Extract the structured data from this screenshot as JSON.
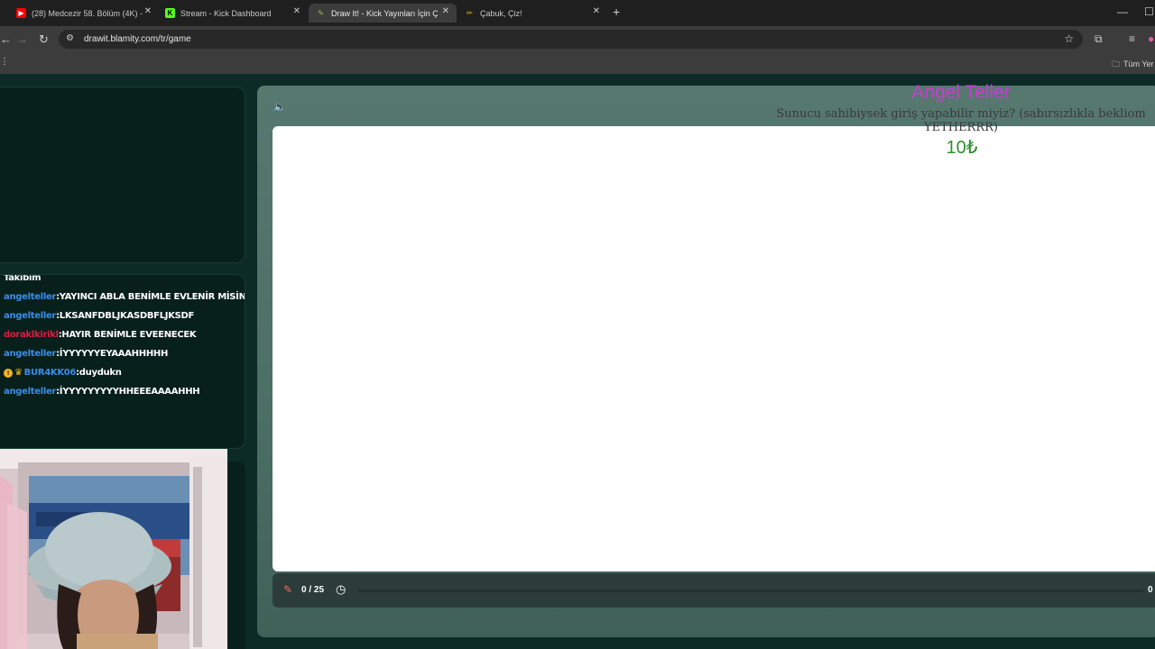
{
  "browser": {
    "tabs": [
      {
        "title": "(28) Medcezir 58. Bölüm (4K) -",
        "icon": "youtube-icon",
        "color": "#ff0000"
      },
      {
        "title": "Stream - Kick Dashboard",
        "icon": "kick-icon",
        "color": "#53fc18"
      },
      {
        "title": "Draw It! - Kick Yayınları İçin Çizi",
        "icon": "drawit-icon",
        "color": "#8bc34a"
      },
      {
        "title": "Çabuk, Çiz!",
        "icon": "pencil-icon",
        "color": "#f2b51f"
      }
    ],
    "url": "drawit.blamity.com/tr/game",
    "bookmarks_all": "Tüm Yer"
  },
  "chat": {
    "partial_line": "Takibim",
    "messages": [
      {
        "user": "angelteller",
        "sep": ":",
        "text": "YAYINCI ABLA BENİMLE EVLENİR MİSİN?",
        "color": "blue"
      },
      {
        "user": "angelteller",
        "sep": ":",
        "text": "LKSANFDBLJKASDBFLJKSDF",
        "color": "blue"
      },
      {
        "user": "doraklkirikl",
        "sep": ":",
        "text": "HAYIR BENİMLE EVEENECEK",
        "color": "red"
      },
      {
        "user": "angelteller",
        "sep": ":",
        "text": "İYYYYYYEYAAAHHHHH",
        "color": "blue"
      },
      {
        "user": "BUR4KK06",
        "sep": ":",
        "text": "duydukn",
        "color": "blue",
        "badges": true
      },
      {
        "user": "angelteller",
        "sep": ":",
        "text": "İYYYYYYYYYHHEEEAAAAHHH",
        "color": "blue"
      }
    ]
  },
  "game": {
    "counter": "0 / 25",
    "right_label": "0"
  },
  "donation": {
    "name": "Angel Teller",
    "message": "Sunucu sahibiysek giriş yapabilir miyiz? (sabırsızlıkla bekliom YETHERRR)",
    "amount": "10₺"
  }
}
